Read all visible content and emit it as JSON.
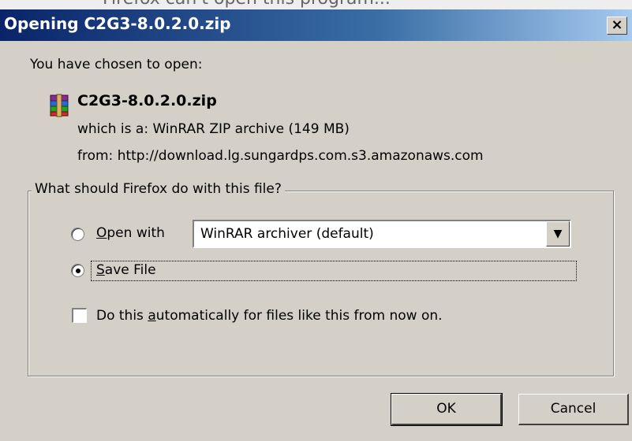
{
  "window": {
    "title": "Opening C2G3-8.0.2.0.zip",
    "close_glyph": "×",
    "background_caption": "Firefox can't open this program..."
  },
  "info": {
    "intro": "You have chosen to open:",
    "filename": "C2G3-8.0.2.0.zip",
    "file_icon": "winrar-archive-icon",
    "type_line": "which is a:  WinRAR ZIP archive (149 MB)",
    "from_line": "from:  http://download.lg.sungardps.com.s3.amazonaws.com"
  },
  "group": {
    "legend": "What should Firefox do with this file?",
    "open_with": {
      "label_first": "O",
      "label_rest": "pen with",
      "selected": false,
      "app_value": "WinRAR archiver (default)"
    },
    "save_file": {
      "label_first": "S",
      "label_rest": "ave File",
      "selected": true
    },
    "auto": {
      "label_pre": "Do this ",
      "label_u": "a",
      "label_post": "utomatically for files like this from now on.",
      "checked": false
    }
  },
  "buttons": {
    "ok": "OK",
    "cancel": "Cancel"
  },
  "colors": {
    "title_start": "#0a246a",
    "title_end": "#a6caf0",
    "dialog_bg": "#d4d0c8"
  }
}
